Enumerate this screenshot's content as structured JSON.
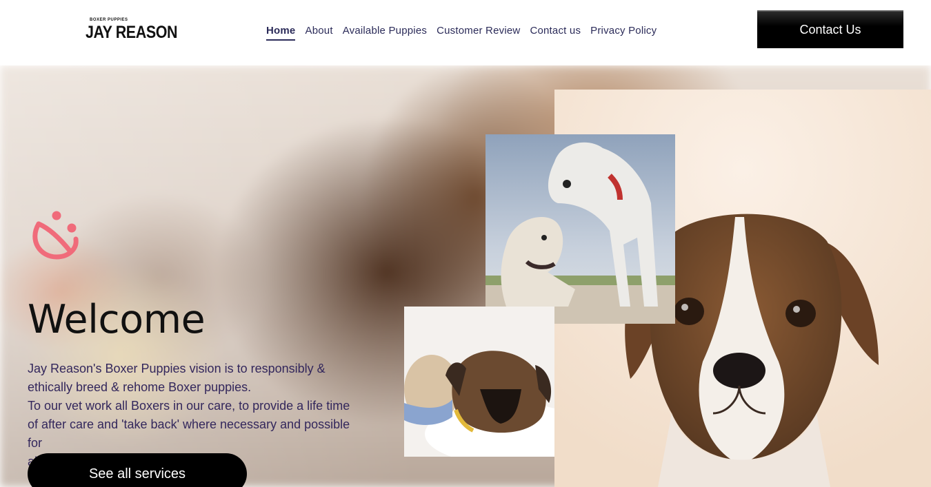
{
  "header": {
    "logo_small": "BOXER PUPPIES",
    "logo_big": "JAY REASON",
    "nav": [
      {
        "label": "Home",
        "active": true
      },
      {
        "label": "About"
      },
      {
        "label": "Available Puppies"
      },
      {
        "label": "Customer Review"
      },
      {
        "label": "Contact us"
      },
      {
        "label": "Privacy Policy"
      }
    ],
    "contact_button": "Contact Us"
  },
  "hero": {
    "title": "Welcome",
    "description_lines": [
      "Jay Reason's Boxer Puppies vision is to responsibly &",
      "ethically breed & rehome Boxer puppies.",
      "To our vet work all Boxers in our care, to provide a life time",
      "of after care and 'take back' where necessary and possible for",
      "all Boxers adopted through our division."
    ],
    "cta_button": "See all services",
    "accent_color": "#f06b7a"
  },
  "colors": {
    "nav_text": "#2b2b59",
    "description_text": "#33275c",
    "button_bg": "#000000"
  }
}
